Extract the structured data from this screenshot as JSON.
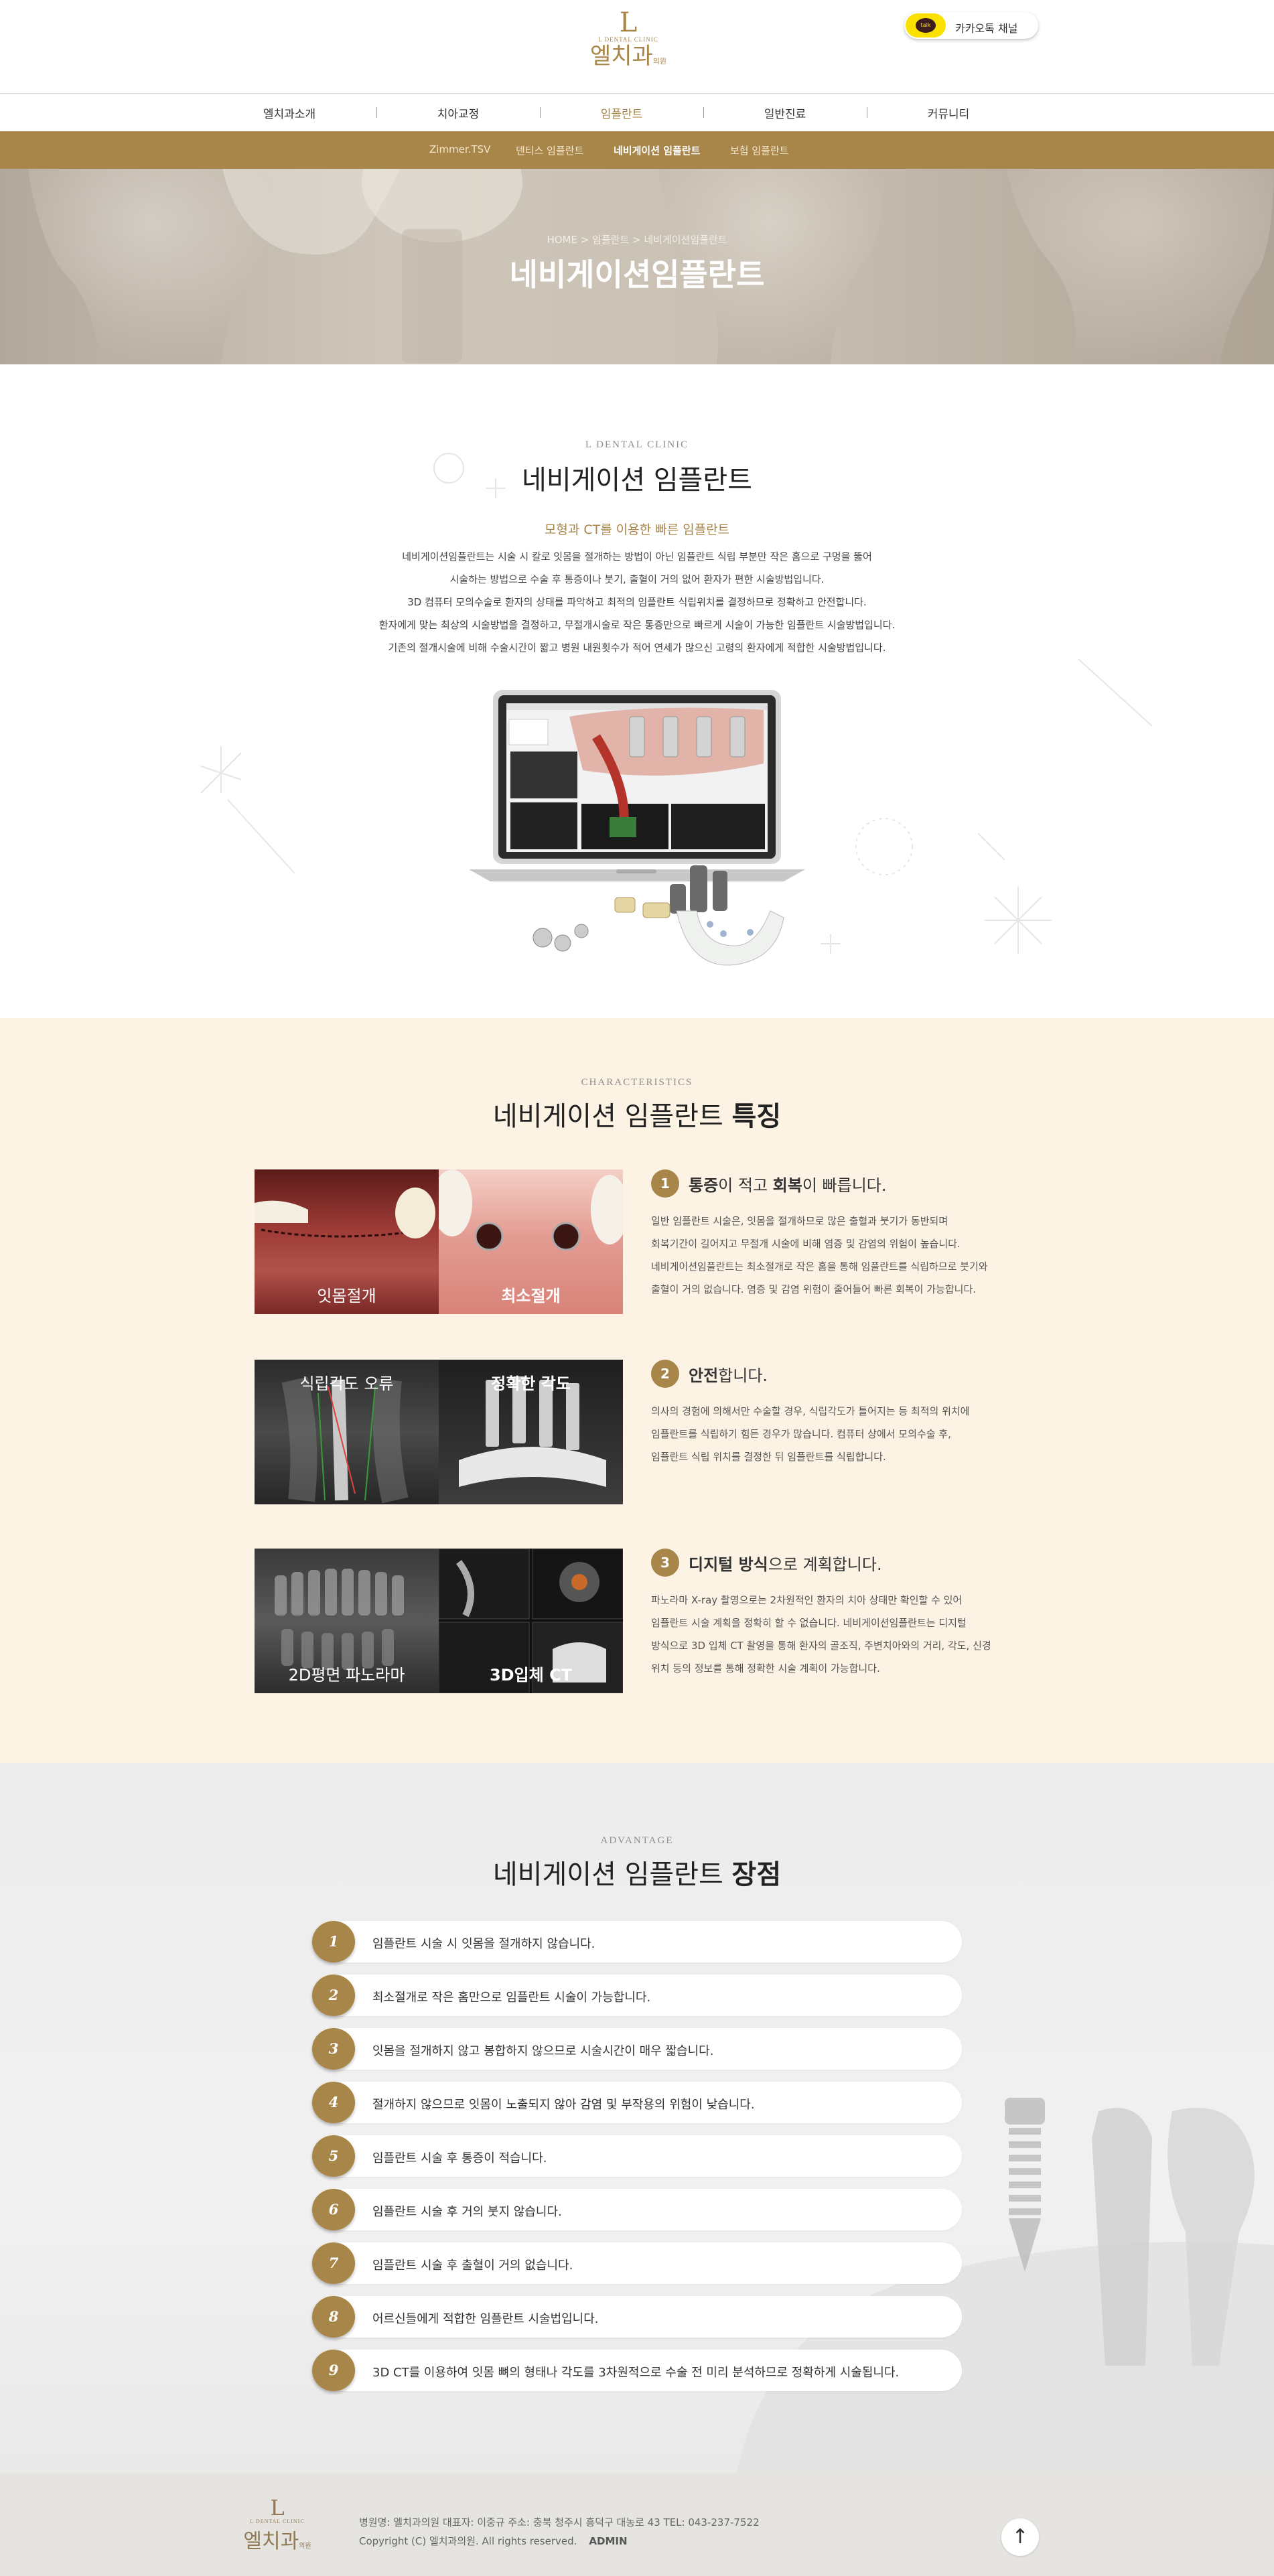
{
  "header": {
    "logo_small": "L DENTAL CLINIC",
    "logo_name": "엘치과",
    "logo_suffix": "의원",
    "kakao_label": "카카오톡 채널",
    "kakao_icon_text": "talk"
  },
  "nav": {
    "items": [
      "엘치과소개",
      "치아교정",
      "임플란트",
      "일반진료",
      "커뮤니티"
    ],
    "active": "임플란트"
  },
  "subnav": {
    "items": [
      "Zimmer.TSV",
      "덴티스 임플란트",
      "네비게이션 임플란트",
      "보험 임플란트"
    ],
    "active": "네비게이션 임플란트"
  },
  "hero": {
    "breadcrumb": "HOME > 임플란트 > 네비게이션임플란트",
    "title": "네비게이션임플란트"
  },
  "intro": {
    "eyebrow": "L DENTAL CLINIC",
    "title": "네비게이션 임플란트",
    "subtitle": "모형과 CT를 이용한 빠른 임플란트",
    "lines": [
      "네비게이션임플란트는 시술 시 칼로 잇몸을 절개하는 방법이 아닌 임플란트 식립 부분만 작은 홈으로 구멍을 뚫어",
      "시술하는 방법으로 수술 후 통증이나 붓기, 출혈이 거의 없어 환자가 편한 시술방법입니다.",
      "3D 컴퓨터 모의수술로 환자의 상태를 파악하고 최적의 임플란트 식립위치를 결정하므로 정확하고 안전합니다.",
      "환자에게 맞는 최상의 시술방법을 결정하고, 무절개시술로 작은 통증만으로 빠르게 시술이 가능한 임플란트 시술방법입니다.",
      "기존의 절개시술에 비해 수술시간이 짧고 병원 내원횟수가 적어 연세가 많으신 고령의 환자에게 적합한 시술방법입니다."
    ]
  },
  "characteristics": {
    "eyebrow": "CHARACTERISTICS",
    "title_normal": "네비게이션 임플란트 ",
    "title_bold": "특징",
    "items": [
      {
        "num": "1",
        "title_parts": [
          "통증",
          "이 적고 ",
          "회복",
          "이 빠릅니다."
        ],
        "captions": [
          "잇몸절개",
          "최소절개"
        ],
        "lines": [
          "일반 임플란트 시술은, 잇몸을 절개하므로 많은 출혈과 붓기가 동반되며",
          "회복기간이 길어지고 무절개 시술에 비해 염증 및 감염의 위험이 높습니다.",
          "네비게이션임플란트는 최소절개로 작은 홈을 통해 임플란트를 식립하므로 붓기와",
          "출혈이 거의 없습니다. 염증 및 감염 위험이 줄어들어 빠른 회복이 가능합니다."
        ]
      },
      {
        "num": "2",
        "title_parts": [
          "안전",
          "합니다."
        ],
        "captions": [
          "식립각도 오류",
          "정확한 각도"
        ],
        "lines": [
          "의사의 경험에 의해서만 수술할 경우, 식립각도가 틀어지는 등 최적의 위치에",
          "임플란트를 식립하기 힘든 경우가 많습니다. 컴퓨터 상에서 모의수술 후,",
          "임플란트 식립 위치를 결정한 뒤 임플란트를 식립합니다."
        ]
      },
      {
        "num": "3",
        "title_parts": [
          "디지털 방식",
          "으로 계획합니다."
        ],
        "captions": [
          "2D평면 파노라마",
          "3D입체 CT"
        ],
        "lines": [
          "파노라마 X-ray 촬영으로는 2차원적인 환자의 치아 상태만 확인할 수 있어",
          "임플란트 시술 계획을 정확히 할 수 없습니다. 네비게이션임플란트는 디지털",
          "방식으로 3D 입체 CT 촬영을 통해 환자의 골조직, 주변치아와의 거리, 각도, 신경",
          "위치 등의 정보를 통해 정확한 시술 계획이 가능합니다."
        ]
      }
    ]
  },
  "advantage": {
    "eyebrow": "ADVANTAGE",
    "title_normal": "네비게이션 임플란트 ",
    "title_bold": "장점",
    "items": [
      {
        "num": "1",
        "text": "임플란트 시술 시 잇몸을 절개하지 않습니다."
      },
      {
        "num": "2",
        "text": "최소절개로 작은 홈만으로 임플란트 시술이 가능합니다."
      },
      {
        "num": "3",
        "text": "잇몸을 절개하지 않고 봉합하지 않으므로 시술시간이 매우 짧습니다."
      },
      {
        "num": "4",
        "text": "절개하지 않으므로 잇몸이 노출되지 않아 감염 및 부작용의 위험이 낮습니다."
      },
      {
        "num": "5",
        "text": "임플란트 시술 후 통증이 적습니다."
      },
      {
        "num": "6",
        "text": "임플란트 시술 후 거의 붓지 않습니다."
      },
      {
        "num": "7",
        "text": "임플란트 시술 후 출혈이 거의 없습니다."
      },
      {
        "num": "8",
        "text": "어르신들에게 적합한 임플란트 시술법입니다."
      },
      {
        "num": "9",
        "text": "3D CT를 이용하여 잇몸 뼈의 형태나 각도를 3차원적으로 수술 전 미리 분석하므로 정확하게 시술됩니다."
      }
    ]
  },
  "footer": {
    "line1": "병원명: 엘치과의원   대표자: 이중규   주소: 충북 청주시 흥덕구 대농로 43   TEL: 043-237-7522",
    "copyright": "Copyright (C) 엘치과의원. All rights reserved.",
    "admin": "ADMIN",
    "top_arrow": "↑"
  },
  "colors": {
    "gold": "#a88548",
    "cream": "#fdf3e5",
    "kakao": "#fae100"
  }
}
